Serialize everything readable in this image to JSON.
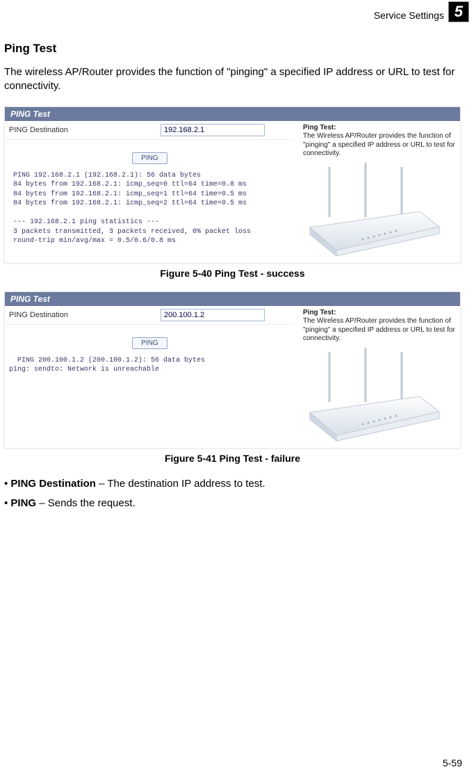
{
  "header": {
    "section": "Service Settings",
    "chapter": "5"
  },
  "title": "Ping Test",
  "intro": "The wireless AP/Router provides the function of \"pinging\" a specified IP address or URL to test for connectivity.",
  "figures": [
    {
      "panel_title": "PING Test",
      "dest_label": "PING Destination",
      "dest_value": "192.168.2.1",
      "btn": "PING",
      "help_title": "Ping Test:",
      "help_text": "The Wireless AP/Router provides the function of \"pinging\" a specified IP address or URL to test for connectivity.",
      "output": " PING 192.168.2.1 (192.168.2.1): 56 data bytes\n 84 bytes from 192.168.2.1: icmp_seq=0 ttl=64 time=0.8 ms\n 84 bytes from 192.168.2.1: icmp_seq=1 ttl=64 time=0.5 ms\n 84 bytes from 192.168.2.1: icmp_seq=2 ttl=64 time=0.5 ms\n\n --- 192.168.2.1 ping statistics ---\n 3 packets transmitted, 3 packets received, 0% packet loss\n round-trip min/avg/max = 0.5/0.6/0.8 ms",
      "caption": "Figure 5-40  Ping Test - success"
    },
    {
      "panel_title": "PING Test",
      "dest_label": "PING Destination",
      "dest_value": "200.100.1.2",
      "btn": "PING",
      "help_title": "Ping Test:",
      "help_text": "The Wireless AP/Router provides the function of \"pinging\" a specified IP address or URL to test for connectivity.",
      "output": "  PING 200.100.1.2 (200.100.1.2): 56 data bytes\nping: sendto: Network is unreachable",
      "caption": "Figure 5-41  Ping Test - failure"
    }
  ],
  "bullets": [
    {
      "term": "PING Destination",
      "text": " – The destination IP address to test."
    },
    {
      "term": "PING ",
      "text": " – Sends the request."
    }
  ],
  "footer": "5-59"
}
